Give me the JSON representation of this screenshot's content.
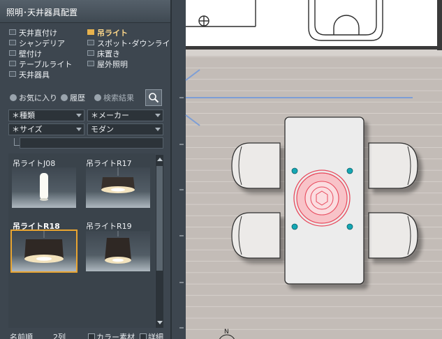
{
  "panel": {
    "title": "照明･天井器具配置",
    "categories_left": [
      "天井直付け",
      "シャンデリア",
      "壁付け",
      "テーブルライト",
      "天井器具"
    ],
    "categories_right": [
      "吊ライト",
      "スポット･ダウンライト",
      "床置き",
      "屋外照明"
    ],
    "selected_category": "吊ライト"
  },
  "toolbar": {
    "favorites_label": "お気に入り",
    "history_label": "履歴",
    "search_results_label": "検索結果"
  },
  "filters": {
    "type": "＊種類",
    "maker": "＊メーカー",
    "size": "＊サイズ",
    "style": "モダン"
  },
  "items": [
    {
      "label": "吊ライトJ08",
      "selected": false
    },
    {
      "label": "吊ライトR17",
      "selected": false
    },
    {
      "label": "吊ライトR18",
      "selected": true
    },
    {
      "label": "吊ライトR19",
      "selected": false
    }
  ],
  "bottom": {
    "sort_label": "名前順",
    "columns_label": "2列",
    "fabric_label": "カラー素材",
    "detail_label": "詳細"
  },
  "plan": {
    "north_label": "N"
  },
  "colors": {
    "accent_selection": "#e9a531",
    "floor": "#c2bbb6",
    "light_fixture": "#e8495c",
    "outlet_dots": "#14a7b4"
  }
}
